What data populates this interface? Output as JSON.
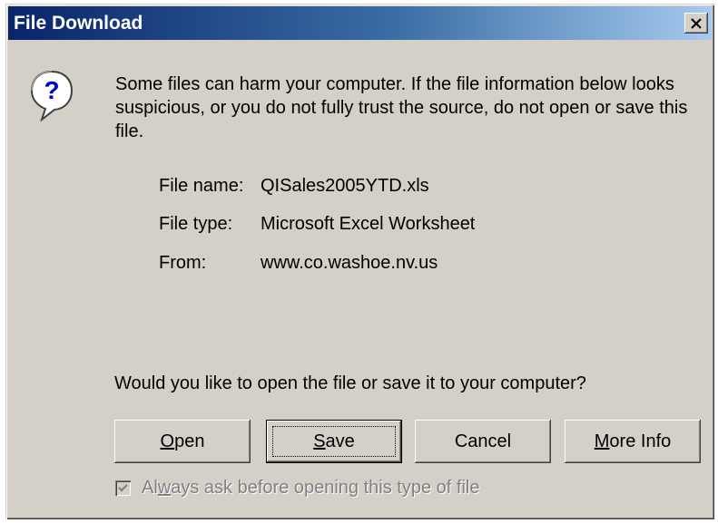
{
  "window": {
    "title": "File Download",
    "close_label": "×"
  },
  "message": "Some files can harm your computer. If the file information below looks suspicious, or you do not fully trust the source, do not open or save this file.",
  "file_info": [
    {
      "label": "File name:",
      "value": "QISales2005YTD.xls"
    },
    {
      "label": "File type:",
      "value": "Microsoft Excel Worksheet"
    },
    {
      "label": "From:",
      "value": "www.co.washoe.nv.us"
    }
  ],
  "question": "Would you like to open the file or save it to your computer?",
  "buttons": {
    "open": {
      "underlined": "O",
      "rest": "pen"
    },
    "save": {
      "underlined": "S",
      "rest": "ave"
    },
    "cancel": "Cancel",
    "more_info": {
      "underlined": "M",
      "rest": "ore Info"
    }
  },
  "always_ask": {
    "before": "Al",
    "underlined": "w",
    "after": "ays ask before opening this type of file",
    "checked": true,
    "enabled": false
  },
  "icons": {
    "warning": "question-balloon-icon",
    "close": "close-icon",
    "check": "checkmark-icon"
  }
}
